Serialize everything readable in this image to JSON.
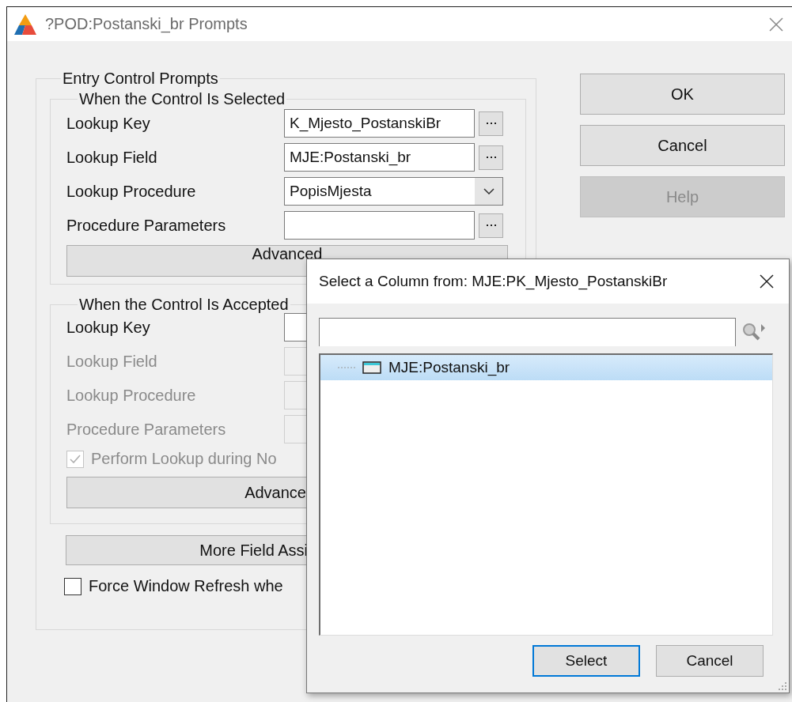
{
  "window": {
    "title": "?POD:Postanski_br Prompts"
  },
  "entry_group": {
    "title": "Entry Control Prompts",
    "selected_group": {
      "title": "When the Control Is Selected",
      "rows": [
        {
          "kind": "ellipsis",
          "label": "Lookup Key",
          "value": "K_Mjesto_PostanskiBr",
          "disabled": false
        },
        {
          "kind": "ellipsis",
          "label": "Lookup Field",
          "value": "MJE:Postanski_br",
          "disabled": false
        },
        {
          "kind": "dropdown",
          "label": "Lookup Procedure",
          "value": "PopisMjesta",
          "disabled": false
        },
        {
          "kind": "ellipsis",
          "label": "Procedure Parameters",
          "disabled": false
        }
      ],
      "button": "Advanced"
    },
    "accepted_group": {
      "title": "When the Control Is Accepted",
      "rows": [
        {
          "label": "Lookup Key",
          "disabled": false
        },
        {
          "label": "Lookup Field",
          "disabled": true
        },
        {
          "label": "Lookup Procedure",
          "disabled": true
        },
        {
          "label": "Procedure Parameters",
          "disabled": true
        }
      ],
      "checkbox": {
        "label": "Perform Lookup during No",
        "checked": true,
        "disabled": true
      },
      "button": "Advance"
    },
    "more_button": "More Field Assi",
    "force_checkbox": {
      "label": "Force Window Refresh whe",
      "checked": false,
      "disabled": false
    }
  },
  "buttons": [
    {
      "label": "OK",
      "disabled": false
    },
    {
      "label": "Cancel",
      "disabled": false
    },
    {
      "label": "Help",
      "disabled": true
    }
  ],
  "column_dialog": {
    "title": "Select a Column from: MJE:PK_Mjesto_PostanskiBr",
    "tree": [
      {
        "label": "MJE:Postanski_br",
        "selected": true
      }
    ],
    "buttons": [
      {
        "label": "Select",
        "default": true
      },
      {
        "label": "Cancel",
        "default": false
      }
    ]
  }
}
